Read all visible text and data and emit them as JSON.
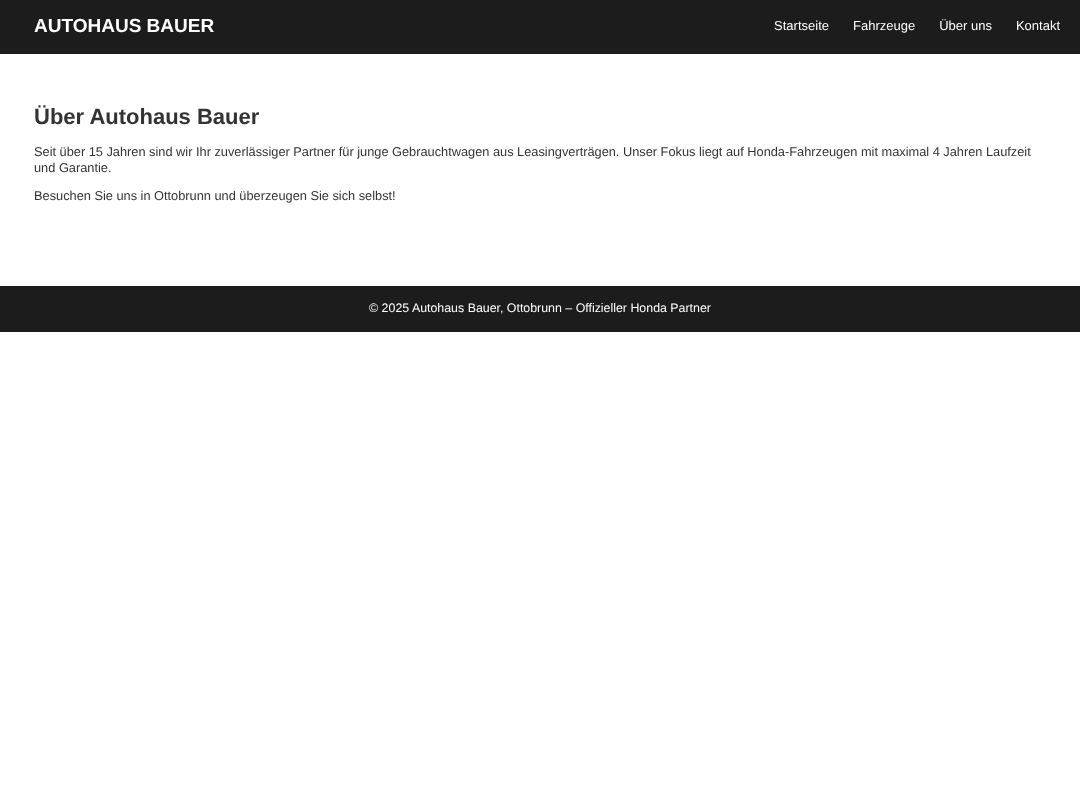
{
  "header": {
    "logo": "AUTOHAUS BAUER",
    "nav": [
      {
        "label": "Startseite"
      },
      {
        "label": "Fahrzeuge"
      },
      {
        "label": "Über uns"
      },
      {
        "label": "Kontakt"
      }
    ]
  },
  "main": {
    "heading": "Über Autohaus Bauer",
    "paragraphs": [
      "Seit über 15 Jahren sind wir Ihr zuverlässiger Partner für junge Gebrauchtwagen aus Leasingverträgen. Unser Fokus liegt auf Honda-Fahrzeugen mit maximal 4 Jahren Laufzeit und Garantie.",
      "Besuchen Sie uns in Ottobrunn und überzeugen Sie sich selbst!"
    ]
  },
  "footer": {
    "text": "© 2025 Autohaus Bauer, Ottobrunn – Offizieller Honda Partner"
  }
}
